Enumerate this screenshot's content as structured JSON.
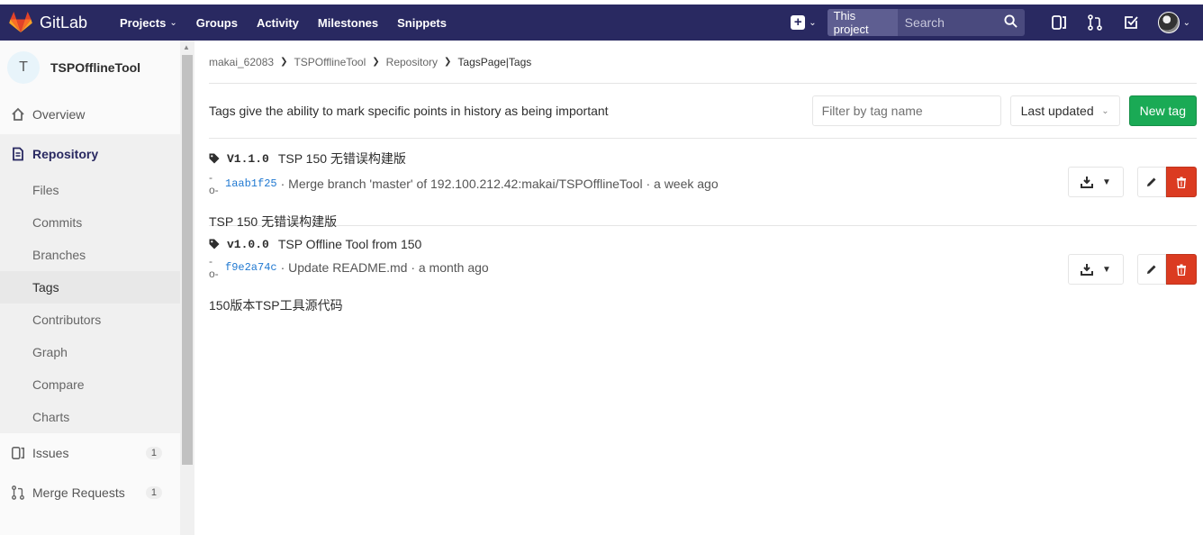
{
  "app": {
    "brand": "GitLab"
  },
  "nav": {
    "links": [
      "Projects",
      "Groups",
      "Activity",
      "Milestones",
      "Snippets"
    ],
    "search_scope": "This project",
    "search_placeholder": "Search"
  },
  "sidebar": {
    "project_initial": "T",
    "project_name": "TSPOfflineTool",
    "overview": "Overview",
    "repository": "Repository",
    "repo_items": [
      "Files",
      "Commits",
      "Branches",
      "Tags",
      "Contributors",
      "Graph",
      "Compare",
      "Charts"
    ],
    "issues": "Issues",
    "issues_count": "1",
    "merge_requests": "Merge Requests",
    "merge_requests_count": "1"
  },
  "breadcrumb": [
    "makai_62083",
    "TSPOfflineTool",
    "Repository",
    "TagsPage|Tags"
  ],
  "tags_page": {
    "description": "Tags give the ability to mark specific points in history as being important",
    "filter_placeholder": "Filter by tag name",
    "sort_label": "Last updated",
    "new_tag_label": "New tag"
  },
  "tags": [
    {
      "name": "V1.1.0",
      "message": "TSP 150 无错误构建版",
      "sha": "1aab1f25",
      "commit_text": "· Merge branch 'master' of 192.100.212.42:makai/TSPOfflineTool · a week ago",
      "release_note": "TSP 150 无错误构建版"
    },
    {
      "name": "v1.0.0",
      "message": "TSP Offline Tool from 150",
      "sha": "f9e2a74c",
      "commit_text": "· Update README.md · a month ago",
      "release_note": "150版本TSP工具源代码"
    }
  ],
  "colors": {
    "navbar": "#292961",
    "new_tag": "#1aaa55",
    "delete": "#db3b21",
    "sha_link": "#1f78d1"
  }
}
